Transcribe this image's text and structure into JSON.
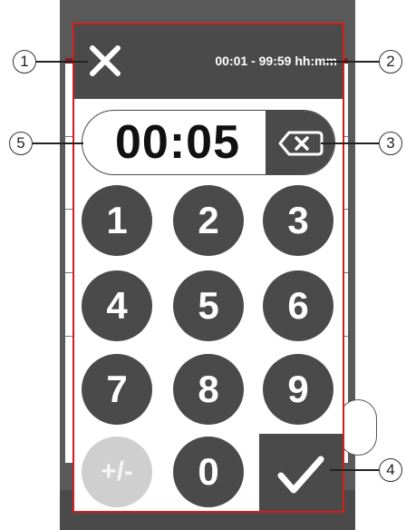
{
  "dialog": {
    "range_hint": "00:01 - 99:59 hh:mm",
    "display_value": "00:05"
  },
  "keypad": {
    "keys": [
      "1",
      "2",
      "3",
      "4",
      "5",
      "6",
      "7",
      "8",
      "9",
      "0"
    ],
    "sign_toggle": "+/-"
  },
  "callouts": [
    "1",
    "2",
    "3",
    "4",
    "5"
  ],
  "icons": {
    "close": "close-icon",
    "backspace": "backspace-icon",
    "confirm": "checkmark-icon"
  },
  "colors": {
    "dark": "#4a4a4a",
    "frame": "#d81b1b",
    "disabled": "#cfcfcf"
  }
}
